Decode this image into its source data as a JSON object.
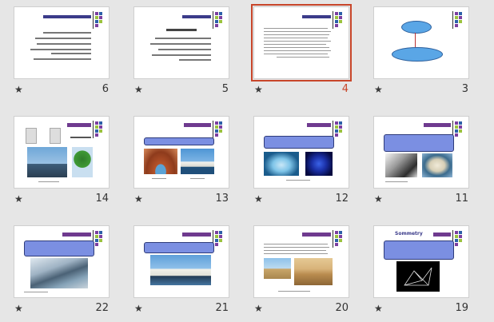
{
  "slide_panel": {
    "rows": [
      [
        {
          "number": "6",
          "selected": false
        },
        {
          "number": "5",
          "selected": false
        },
        {
          "number": "4",
          "selected": true
        },
        {
          "number": "3",
          "selected": false
        }
      ],
      [
        {
          "number": "14",
          "selected": false
        },
        {
          "number": "13",
          "selected": false
        },
        {
          "number": "12",
          "selected": false
        },
        {
          "number": "11",
          "selected": false
        }
      ],
      [
        {
          "number": "22",
          "selected": false
        },
        {
          "number": "21",
          "selected": false
        },
        {
          "number": "20",
          "selected": false
        },
        {
          "number": "19",
          "selected": false
        }
      ]
    ],
    "star_glyph": "★",
    "slide_19_title_word": "Sommetry",
    "colors": {
      "selected_outline": "#c8462a",
      "background": "#e6e6e6",
      "accent_box": "#7b8fe2"
    }
  }
}
